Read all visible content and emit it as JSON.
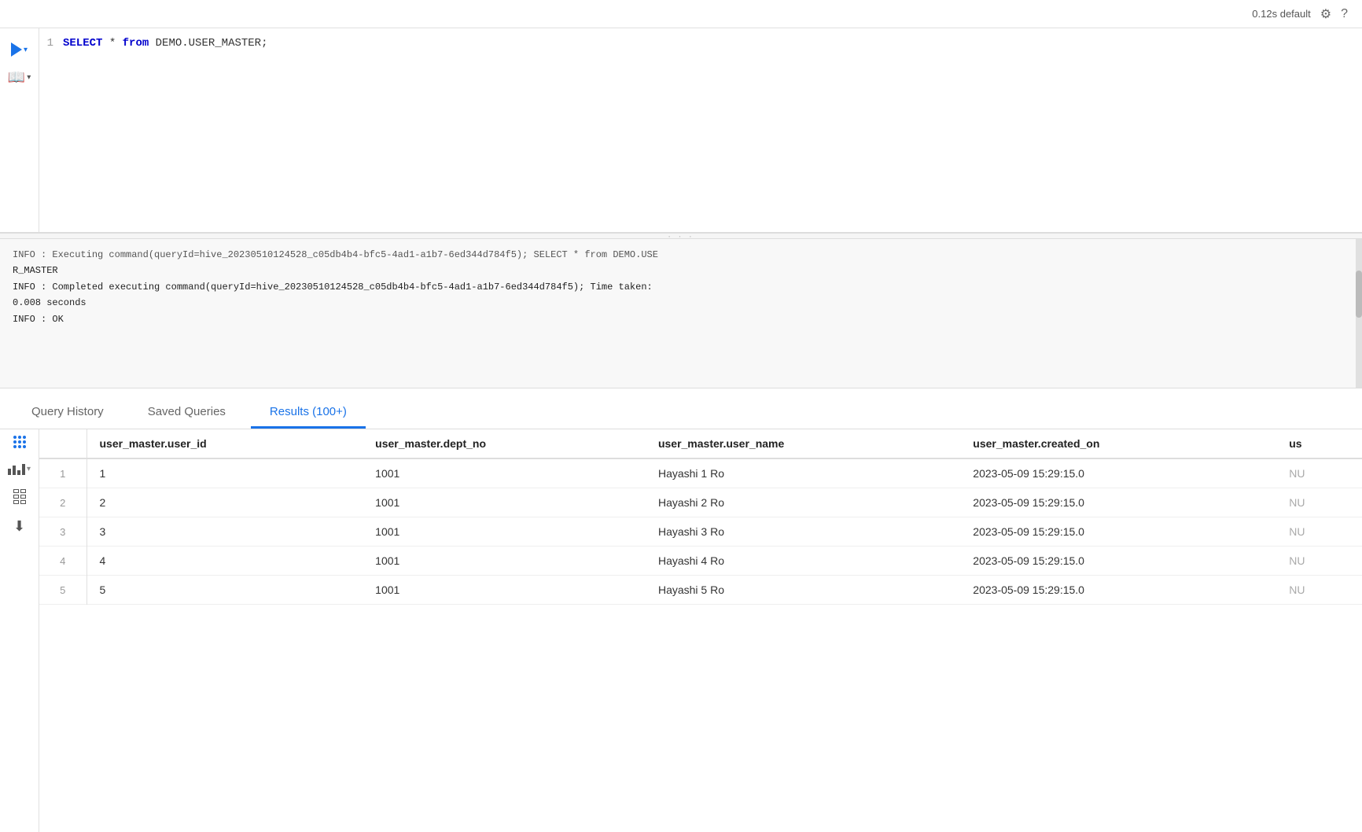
{
  "toolbar": {
    "timing": "0.12s default",
    "settings_label": "⚙",
    "help_label": "?"
  },
  "editor": {
    "line_number": "1",
    "code_line": "SELECT * from DEMO.USER_MASTER;"
  },
  "log": {
    "lines": [
      "INFO   : Executing command(queryId=hive_20230510124528_c05db4b4-bfc5-4ad1-a1b7-6ed344d784f5); SELECT * from DEMO.USER_MASTER",
      "R_MASTER",
      "INFO   : Completed executing command(queryId=hive_20230510124528_c05db4b4-bfc5-4ad1-a1b7-6ed344d784f5); Time taken: 0.008 seconds",
      "INFO   : OK"
    ]
  },
  "tabs": [
    {
      "id": "query-history",
      "label": "Query History",
      "active": false
    },
    {
      "id": "saved-queries",
      "label": "Saved Queries",
      "active": false
    },
    {
      "id": "results",
      "label": "Results (100+)",
      "active": true
    }
  ],
  "table": {
    "columns": [
      {
        "id": "row-num",
        "label": ""
      },
      {
        "id": "user-id",
        "label": "user_master.user_id"
      },
      {
        "id": "dept-no",
        "label": "user_master.dept_no"
      },
      {
        "id": "user-name",
        "label": "user_master.user_name"
      },
      {
        "id": "created-on",
        "label": "user_master.created_on"
      },
      {
        "id": "extra",
        "label": "us"
      }
    ],
    "rows": [
      {
        "rownum": "1",
        "user_id": "1",
        "dept_no": "1001",
        "user_name": "Hayashi 1 Ro",
        "created_on": "2023-05-09 15:29:15.0",
        "extra": "NU"
      },
      {
        "rownum": "2",
        "user_id": "2",
        "dept_no": "1001",
        "user_name": "Hayashi 2 Ro",
        "created_on": "2023-05-09 15:29:15.0",
        "extra": "NU"
      },
      {
        "rownum": "3",
        "user_id": "3",
        "dept_no": "1001",
        "user_name": "Hayashi 3 Ro",
        "created_on": "2023-05-09 15:29:15.0",
        "extra": "NU"
      },
      {
        "rownum": "4",
        "user_id": "4",
        "dept_no": "1001",
        "user_name": "Hayashi 4 Ro",
        "created_on": "2023-05-09 15:29:15.0",
        "extra": "NU"
      },
      {
        "rownum": "5",
        "user_id": "5",
        "dept_no": "1001",
        "user_name": "Hayashi 5 Ro",
        "created_on": "2023-05-09 15:29:15.0",
        "extra": "NU"
      }
    ]
  }
}
